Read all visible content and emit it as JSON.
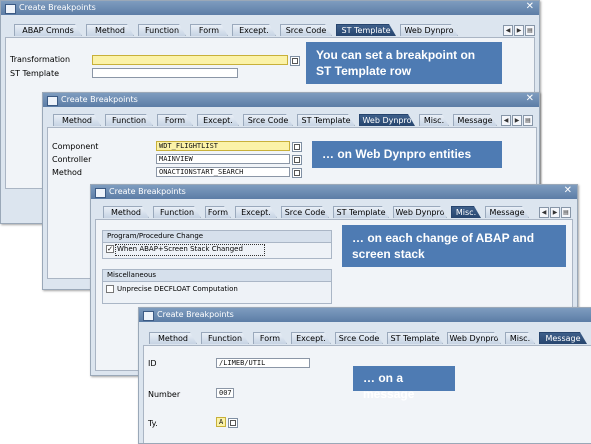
{
  "dialog_title": "Create Breakpoints",
  "close_glyph": "✕",
  "tabs_all": [
    "ABAP Cmnds",
    "Method",
    "Function",
    "Form",
    "Except.",
    "Srce Code",
    "ST Template",
    "Web Dynpro",
    "Misc.",
    "Message"
  ],
  "d1": {
    "tabs": [
      "ABAP Cmnds",
      "Method",
      "Function",
      "Form",
      "Except.",
      "Srce Code",
      "ST Template",
      "Web Dynpro"
    ],
    "active_tab": "ST Template",
    "fields": [
      {
        "label": "Transformation",
        "value": ""
      },
      {
        "label": "ST Template",
        "value": ""
      }
    ],
    "callout": "You can set a breakpoint on ST Template row"
  },
  "d2": {
    "tabs": [
      "Method",
      "Function",
      "Form",
      "Except.",
      "Srce Code",
      "ST Template",
      "Web Dynpro",
      "Misc.",
      "Message"
    ],
    "active_tab": "Web Dynpro",
    "fields": [
      {
        "label": "Component",
        "value": "WDT_FLIGHTLIST"
      },
      {
        "label": "Controller",
        "value": "MAINVIEW"
      },
      {
        "label": "Method",
        "value": "ONACTIONSTART_SEARCH"
      }
    ],
    "callout": "… on Web Dynpro entities"
  },
  "d3": {
    "tabs": [
      "Method",
      "Function",
      "Form",
      "Except.",
      "Srce Code",
      "ST Template",
      "Web Dynpro",
      "Misc.",
      "Message"
    ],
    "active_tab": "Misc.",
    "group1": {
      "title": "Program/Procedure Change",
      "checkbox": "When ABAP+Screen Stack Changed",
      "checked": true
    },
    "group2": {
      "title": "Miscellaneous",
      "checkbox": "Unprecise DECFLOAT Computation",
      "checked": false
    },
    "callout": "… on each change of ABAP and screen stack"
  },
  "d4": {
    "tabs": [
      "Method",
      "Function",
      "Form",
      "Except.",
      "Srce Code",
      "ST Template",
      "Web Dynpro",
      "Misc.",
      "Message"
    ],
    "active_tab": "Message",
    "fields": [
      {
        "label": "ID",
        "value": "/LIMEB/UTIL"
      },
      {
        "label": "Number",
        "value": "007"
      },
      {
        "label": "Ty.",
        "value": "A"
      }
    ],
    "callout": "… on a message"
  }
}
